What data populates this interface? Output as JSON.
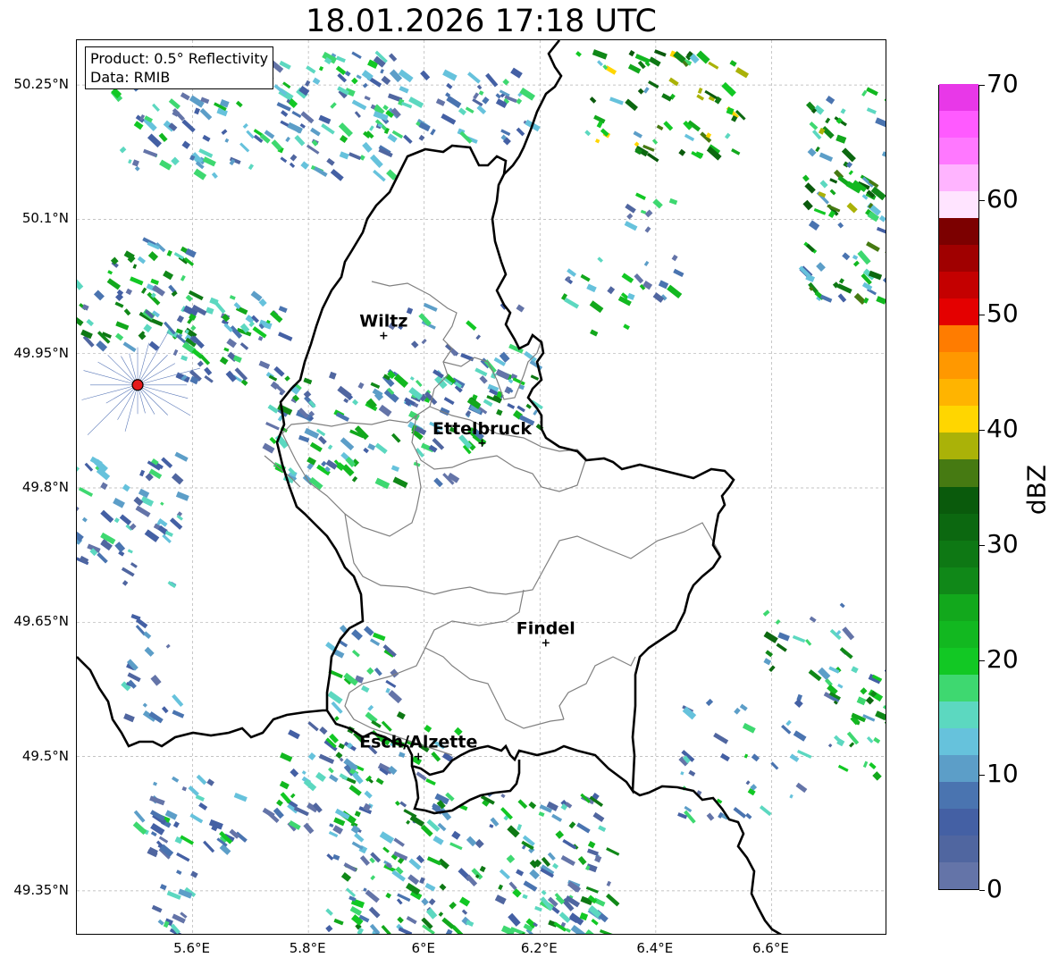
{
  "title": "18.01.2026 17:18 UTC",
  "info": {
    "product": "Product: 0.5° Reflectivity",
    "data": "Data: RMIB"
  },
  "map": {
    "lon_range": [
      5.4,
      6.8
    ],
    "lat_range": [
      49.3,
      50.3
    ],
    "lon_ticks": [
      {
        "value": 5.6,
        "label": "5.6°E"
      },
      {
        "value": 5.8,
        "label": "5.8°E"
      },
      {
        "value": 6.0,
        "label": "6°E"
      },
      {
        "value": 6.2,
        "label": "6.2°E"
      },
      {
        "value": 6.4,
        "label": "6.4°E"
      },
      {
        "value": 6.6,
        "label": "6.6°E"
      }
    ],
    "lat_ticks": [
      {
        "value": 50.25,
        "label": "50.25°N"
      },
      {
        "value": 50.1,
        "label": "50.1°N"
      },
      {
        "value": 49.95,
        "label": "49.95°N"
      },
      {
        "value": 49.8,
        "label": "49.8°N"
      },
      {
        "value": 49.65,
        "label": "49.65°N"
      },
      {
        "value": 49.5,
        "label": "49.5°N"
      },
      {
        "value": 49.35,
        "label": "49.35°N"
      }
    ],
    "cities": [
      {
        "name": "Wiltz",
        "lon": 5.93,
        "lat": 49.97
      },
      {
        "name": "Ettelbruck",
        "lon": 6.1,
        "lat": 49.85
      },
      {
        "name": "Findel",
        "lon": 6.21,
        "lat": 49.627
      },
      {
        "name": "Esch/Alzette",
        "lon": 5.99,
        "lat": 49.5
      }
    ],
    "radar_site": {
      "lon": 5.505,
      "lat": 49.915,
      "color": "#e41a1c"
    }
  },
  "colorbar": {
    "label": "dBZ",
    "min": 0,
    "max": 70,
    "tick_values": [
      0,
      10,
      20,
      30,
      40,
      50,
      60,
      70
    ],
    "tick_labels": [
      "0",
      "10",
      "20",
      "30",
      "40",
      "50",
      "60",
      "70"
    ],
    "colors": [
      "#6474a8",
      "#5066a0",
      "#4460a4",
      "#4a74b0",
      "#5c9ec8",
      "#66c2dc",
      "#5cd8c0",
      "#3ed870",
      "#12c824",
      "#12b820",
      "#12a81c",
      "#108818",
      "#0e7814",
      "#0c6810",
      "#0a5a0c",
      "#467a12",
      "#aab208",
      "#ffd600",
      "#ffb400",
      "#ff9800",
      "#ff7c00",
      "#e40000",
      "#c40000",
      "#a00000",
      "#7c0000",
      "#ffe4ff",
      "#ffb4ff",
      "#ff78ff",
      "#ff5aff",
      "#e838e8"
    ]
  }
}
